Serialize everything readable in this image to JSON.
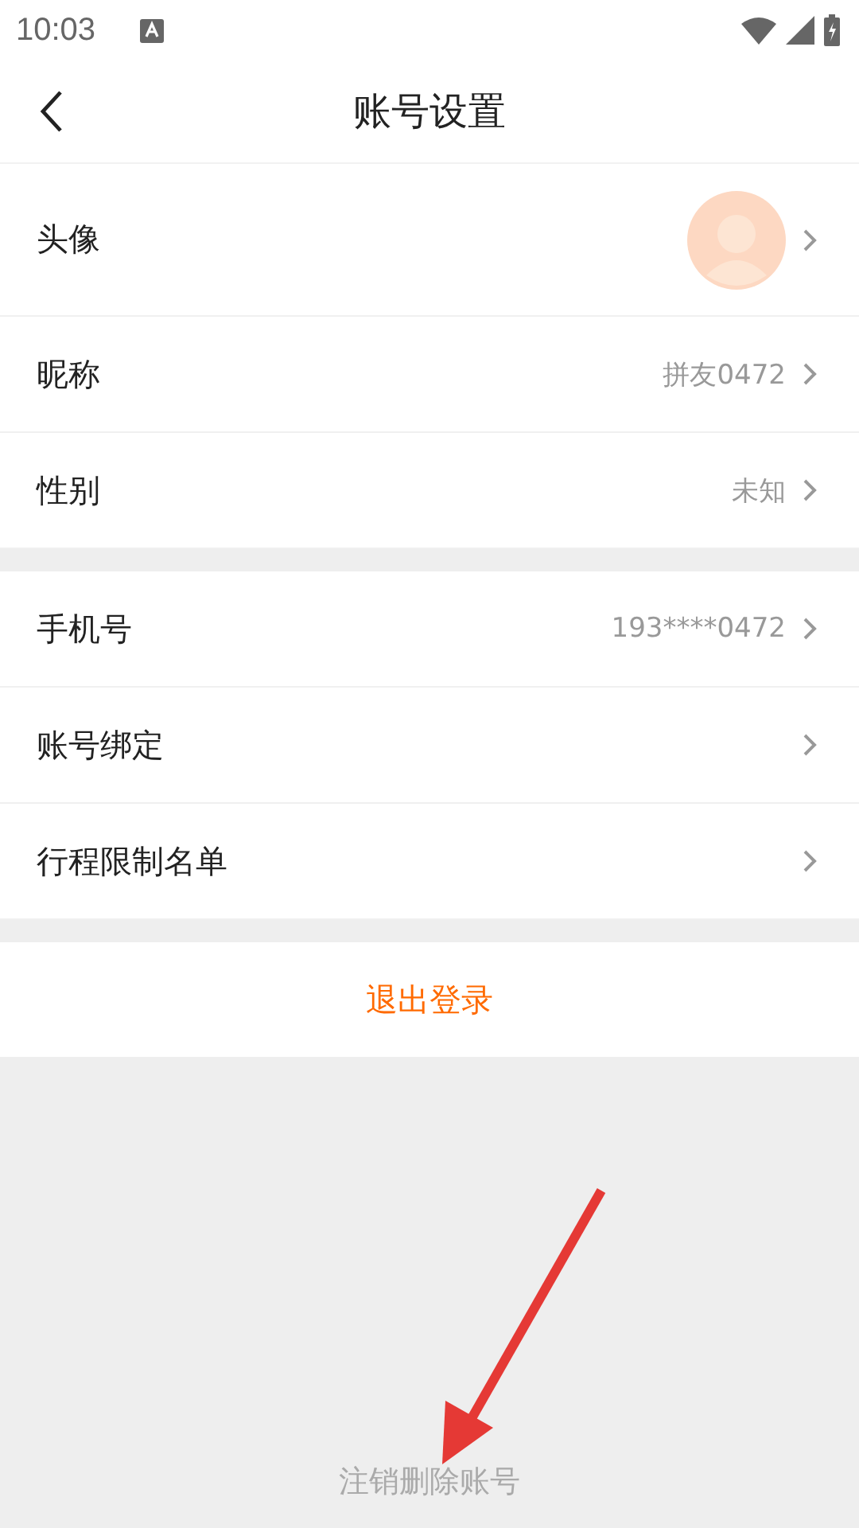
{
  "status_bar": {
    "time": "10:03"
  },
  "header": {
    "title": "账号设置"
  },
  "sections": [
    {
      "rows": [
        {
          "kind": "avatar",
          "label": "头像"
        },
        {
          "kind": "value",
          "label": "昵称",
          "value": "拼友0472"
        },
        {
          "kind": "value",
          "label": "性别",
          "value": "未知"
        }
      ]
    },
    {
      "rows": [
        {
          "kind": "value",
          "label": "手机号",
          "value": "193****0472"
        },
        {
          "kind": "plain",
          "label": "账号绑定"
        },
        {
          "kind": "plain",
          "label": "行程限制名单"
        }
      ]
    }
  ],
  "logout_button": "退出登录",
  "delete_account_link": "注销删除账号"
}
